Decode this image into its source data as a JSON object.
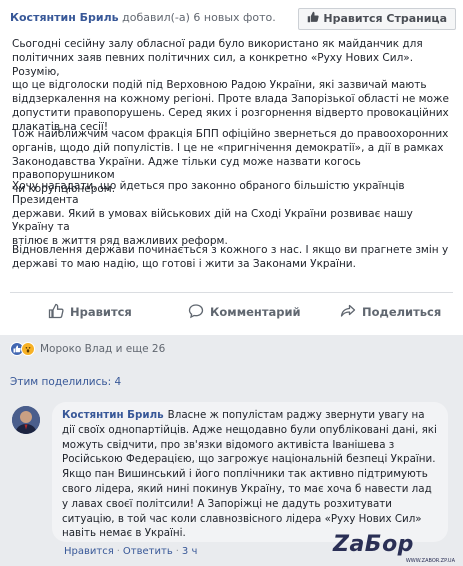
{
  "post": {
    "author": "Костянтин Бриль",
    "action_text": "добавил(-а) 6 новых фото.",
    "like_page_label": "Нравится Страница",
    "paragraphs": [
      "Сьогодні сесійну залу обласної ради було використано як майданчик для\nполітичних заяв певних політичних сил, а конкретно «Руху Нових Сил». Розумію,\nщо це відголоски подій під Верховною Радою України, які зазвичай мають\nвіддзеркалення на кожному регіоні. Проте влада Запорізької області не може\nдопустити правопорушень. Серед яких і розгорнення відверто провокаційних\nплакатів на сесії!",
      "Тож найближчим часом фракція БПП офіційно звернеться до правоохоронних\nорганів, щодо дій популістів. І це не «пригнічення демократії», а дії в рамках\nЗаконодавства України. Адже тільки суд може назвати когось правопорушником\nчи корупціонером.",
      "Хочу нагадати, що йдеться про законно обраного більшістю українців Президента\nдержави. Який в умовах військових дій на Сході України розвиває нашу Україну та\nвтілює в життя ряд важливих реформ.",
      "Відновлення держави починається з кожного з нас. І якщо ви прагнете змін у\nдержаві то маю надію, що готові і жити за Законами України."
    ],
    "actions": {
      "like": "Нравится",
      "comment": "Комментарий",
      "share": "Поделиться"
    }
  },
  "reactions": {
    "text": "Мороко Влад и еще 26"
  },
  "shares_text": "Этим поделились: 4",
  "comment": {
    "author": "Костянтин Бриль",
    "text": "Власне ж популістам раджу звернути увагу на дії своїх однопартійців. Адже нещодавно були опубліковані дані, які можуть свідчити, про зв'язки відомого активіста Іванішева з Російською Федерацією, що загрожує національній безпеці України. Якщо пан Вишинський і його поплічники так активно підтримують свого лідера, який нині покинув Україну, то має хоча б навести лад у лавах своєї політсили! А Запоріжці не дадуть розхитувати ситуацію, в той час коли славнозвісного лідера «Руху Нових Сил» навіть немає в Україні.",
    "like_label": "Нравится",
    "reply_label": "Ответить",
    "time": "3 ч"
  },
  "watermark": {
    "logo_text": "ZаБор",
    "sub_text": "WWW.ZABOR.ZP.UA"
  },
  "colors": {
    "link_blue": "#385898",
    "like_blue": "#4267b2",
    "wow_yellow": "#f7b125",
    "muted": "#606770",
    "bubble_bg": "#f2f3f5",
    "page_bg": "#e9ebee"
  }
}
